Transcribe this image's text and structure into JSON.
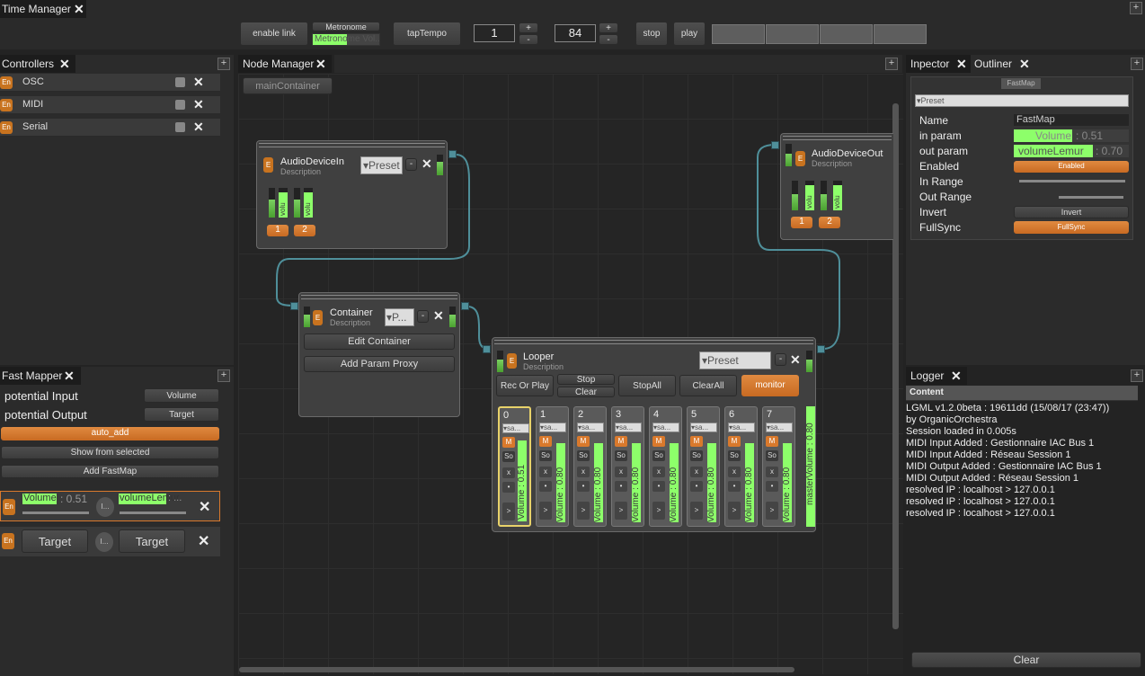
{
  "time_manager": {
    "tab_label": "Time Manager",
    "enable_link": "enable link",
    "metronome": "Metronome",
    "metronome_volume": "Metronome Vol...",
    "tap_tempo": "tapTempo",
    "beats": "1",
    "bpm": "84",
    "plus": "+",
    "minus": "-",
    "stop": "stop",
    "play": "play"
  },
  "controllers": {
    "tab_label": "Controllers",
    "items": [
      {
        "name": "OSC",
        "badge": "En"
      },
      {
        "name": "MIDI",
        "badge": "En"
      },
      {
        "name": "Serial",
        "badge": "En"
      }
    ]
  },
  "fast_mapper": {
    "tab_label": "Fast Mapper",
    "potential_input_label": "potential Input",
    "potential_input_value": "Volume",
    "potential_output_label": "potential Output",
    "potential_output_value": "Target",
    "auto_add": "auto_add",
    "show_from_selected": "Show from selected",
    "add_fastmap": "Add FastMap",
    "mappings": [
      {
        "badge": "En",
        "input": "Volume",
        "input_value": ": 0.51",
        "mid": "I...",
        "output": "volumeLemur",
        "output_value": ": ..."
      },
      {
        "badge": "En",
        "input": "Target",
        "mid": "I...",
        "output": "Target"
      }
    ]
  },
  "node_manager": {
    "tab_label": "Node Manager",
    "breadcrumb": "mainContainer",
    "nodes": {
      "audio_in": {
        "title": "AudioDeviceIn",
        "desc": "Description",
        "preset": "Preset",
        "channels": [
          "1",
          "2"
        ],
        "vol_label": "volu"
      },
      "audio_out": {
        "title": "AudioDeviceOut",
        "desc": "Description",
        "channels": [
          "1",
          "2"
        ],
        "vol_label": "volu"
      },
      "container": {
        "title": "Container",
        "desc": "Description",
        "preset": "P...",
        "edit": "Edit Container",
        "add_proxy": "Add Param Proxy"
      },
      "looper": {
        "title": "Looper",
        "desc": "Description",
        "preset": "Preset",
        "rec_or_play": "Rec Or Play",
        "stop": "Stop",
        "clear": "Clear",
        "stop_all": "StopAll",
        "clear_all": "ClearAll",
        "monitor": "monitor",
        "master_volume": "masterVolume : 0.80",
        "tracks": [
          {
            "num": "0",
            "vol": "Volume : 0.51",
            "sel": "sa..."
          },
          {
            "num": "1",
            "vol": "Volume : 0.80",
            "sel": "sa..."
          },
          {
            "num": "2",
            "vol": "Volume : 0.80",
            "sel": "sa..."
          },
          {
            "num": "3",
            "vol": "Volume : 0.80",
            "sel": "sa..."
          },
          {
            "num": "4",
            "vol": "Volume : 0.80",
            "sel": "sa..."
          },
          {
            "num": "5",
            "vol": "Volume : 0.80",
            "sel": "sa..."
          },
          {
            "num": "6",
            "vol": "Volume : 0.80",
            "sel": "sa..."
          },
          {
            "num": "7",
            "vol": "Volume : 0.80",
            "sel": "sa..."
          }
        ],
        "mute": "M",
        "solo": "So",
        "x": "x",
        "dot": "•",
        "play": ">"
      }
    }
  },
  "inspector": {
    "tab_label": "Inpector",
    "outliner_tab": "Outliner",
    "header": "FastMap",
    "preset": "Preset",
    "rows": [
      {
        "label": "Name",
        "value": "FastMap"
      },
      {
        "label": "in param",
        "value": "Volume",
        "extra": ": 0.51"
      },
      {
        "label": "out param",
        "value": "volumeLemur",
        "extra": ": 0.70"
      },
      {
        "label": "Enabled",
        "value": "Enabled"
      },
      {
        "label": "In Range",
        "value": ""
      },
      {
        "label": "Out Range",
        "value": ""
      },
      {
        "label": "Invert",
        "value": "Invert"
      },
      {
        "label": "FullSync",
        "value": "FullSync"
      }
    ]
  },
  "logger": {
    "tab_label": "Logger",
    "header": "Content",
    "lines": [
      "LGML v1.2.0beta : 19611dd (15/08/17 (23:47))",
      "by OrganicOrchestra",
      "Session loaded in 0.005s",
      "MIDI Input Added : Gestionnaire IAC Bus 1",
      "MIDI Input Added : Réseau Session 1",
      "MIDI Output Added : Gestionnaire IAC Bus 1",
      "MIDI Output Added : Réseau Session 1",
      "resolved IP : localhost > 127.0.0.1",
      "resolved IP : localhost > 127.0.0.1",
      "resolved IP : localhost > 127.0.0.1"
    ],
    "clear": "Clear"
  },
  "colors": {
    "accent_orange": "#d9792c",
    "meter_green": "#8dff6a",
    "port_teal": "#4f8f9a"
  }
}
